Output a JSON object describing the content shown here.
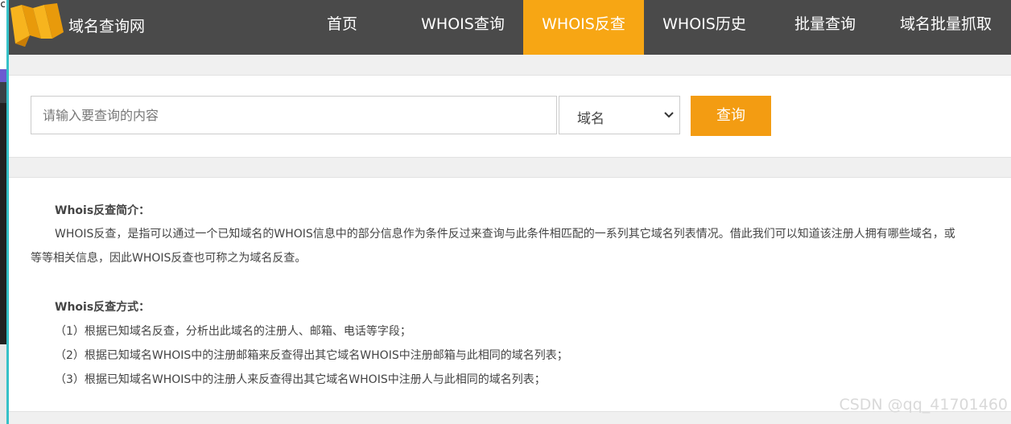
{
  "site": {
    "logo_text": "域名查询网"
  },
  "nav": {
    "items": [
      {
        "label": "首页",
        "active": false
      },
      {
        "label": "WHOIS查询",
        "active": false
      },
      {
        "label": "WHOIS反查",
        "active": true
      },
      {
        "label": "WHOIS历史",
        "active": false
      },
      {
        "label": "批量查询",
        "active": false
      },
      {
        "label": "域名批量抓取",
        "active": false
      }
    ],
    "active_color": "#f7a614",
    "bar_color": "#4a4a4a"
  },
  "search": {
    "placeholder": "请输入要查询的内容",
    "value": "",
    "type_selected": "域名",
    "button_label": "查询",
    "button_color": "#f39c12"
  },
  "intro": {
    "title1": "Whois反查简介：",
    "para_line1": "WHOIS反查，是指可以通过一个已知域名的WHOIS信息中的部分信息作为条件反过来查询与此条件相匹配的一系列其它域名列表情况。借此我们可以知道该注册人拥有哪些域名，或",
    "para_line2": "等等相关信息，因此WHOIS反查也可称之为域名反查。",
    "title2": "Whois反查方式：",
    "methods": [
      "（1）根据已知域名反查，分析出此域名的注册人、邮箱、电话等字段；",
      "（2）根据已知域名WHOIS中的注册邮箱来反查得出其它域名WHOIS中注册邮箱与此相同的域名列表；",
      "（3）根据已知域名WHOIS中的注册人来反查得出其它域名WHOIS中注册人与此相同的域名列表；"
    ]
  },
  "watermark": "CSDN @qq_41701460",
  "edge": {
    "char": "c"
  }
}
